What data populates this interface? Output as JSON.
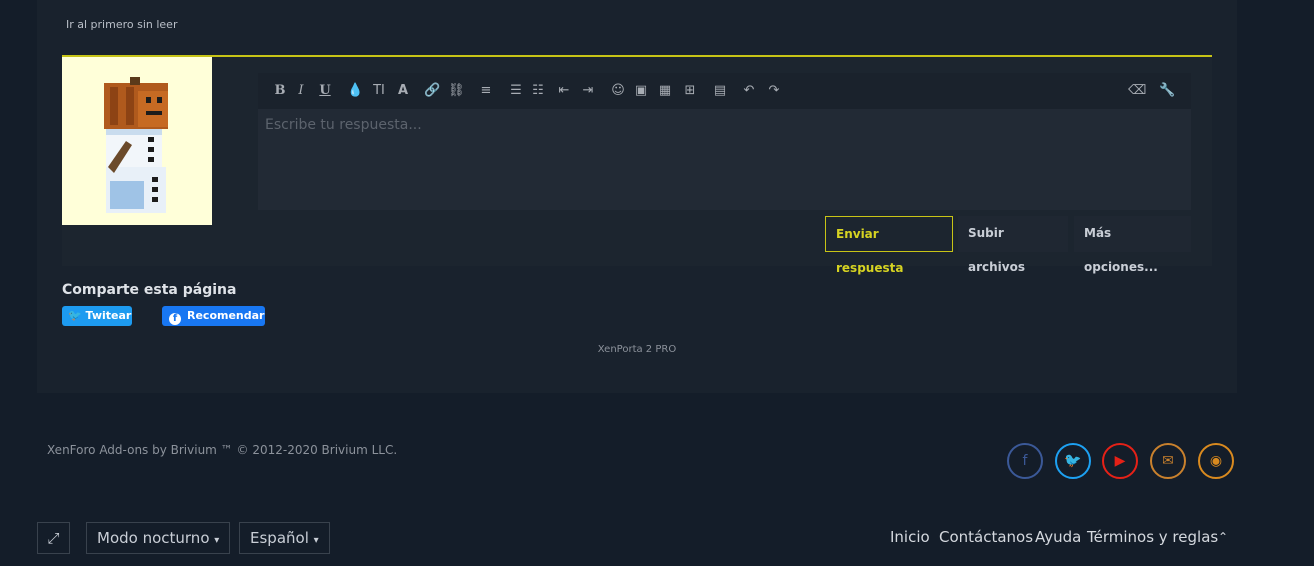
{
  "thread": {
    "unread_link": "Ir al primero sin leer"
  },
  "editor": {
    "placeholder": "Escribe tu respuesta...",
    "toolbar": [
      {
        "name": "bold-icon",
        "glyph": "B"
      },
      {
        "name": "italic-icon",
        "glyph": "I"
      },
      {
        "name": "underline-icon",
        "glyph": "U"
      },
      {
        "name": "text-color-icon",
        "glyph": "💧"
      },
      {
        "name": "font-size-icon",
        "glyph": "TI"
      },
      {
        "name": "font-family-icon",
        "glyph": "A"
      },
      {
        "name": "link-icon",
        "glyph": "🔗"
      },
      {
        "name": "unlink-icon",
        "glyph": "⛓"
      },
      {
        "name": "align-icon",
        "glyph": "≡"
      },
      {
        "name": "bullet-list-icon",
        "glyph": "☰"
      },
      {
        "name": "numbered-list-icon",
        "glyph": "☷"
      },
      {
        "name": "outdent-icon",
        "glyph": "⇤"
      },
      {
        "name": "indent-icon",
        "glyph": "⇥"
      },
      {
        "name": "smilie-icon",
        "glyph": "☺"
      },
      {
        "name": "image-icon",
        "glyph": "▣"
      },
      {
        "name": "media-icon",
        "glyph": "▦"
      },
      {
        "name": "insert-icon",
        "glyph": "⊞"
      },
      {
        "name": "save-draft-icon",
        "glyph": "▤"
      },
      {
        "name": "undo-icon",
        "glyph": "↶"
      },
      {
        "name": "redo-icon",
        "glyph": "↷"
      },
      {
        "name": "remove-format-icon",
        "glyph": "⌫"
      },
      {
        "name": "tools-icon",
        "glyph": "🔧"
      }
    ],
    "submit_label": "Enviar respuesta",
    "attach_label": "Subir archivos",
    "more_label": "Más opciones..."
  },
  "share": {
    "title": "Comparte esta página",
    "twitter_label": "Twitear",
    "facebook_label": "Recomendar"
  },
  "xenporta": "XenPorta 2 PRO",
  "footer": {
    "copyright": "XenForo Add-ons by Brivium ™ © 2012-2020 Brivium LLC.",
    "social": [
      {
        "name": "facebook-icon",
        "glyph": "f",
        "color": "#3b5998"
      },
      {
        "name": "twitter-icon",
        "glyph": "🐦",
        "color": "#1da1f2"
      },
      {
        "name": "youtube-icon",
        "glyph": "▶",
        "color": "#e62117"
      },
      {
        "name": "email-icon",
        "glyph": "✉",
        "color": "#c9812d"
      },
      {
        "name": "rss-icon",
        "glyph": "◉",
        "color": "#d98a1f"
      }
    ],
    "night_mode_label": "Modo nocturno",
    "language_label": "Español",
    "links": [
      "Inicio",
      "Contáctanos",
      "Ayuda",
      "Términos y reglas"
    ]
  },
  "colors": {
    "accent": "#c7c416",
    "background": "#141d29",
    "panel": "#19222d"
  }
}
